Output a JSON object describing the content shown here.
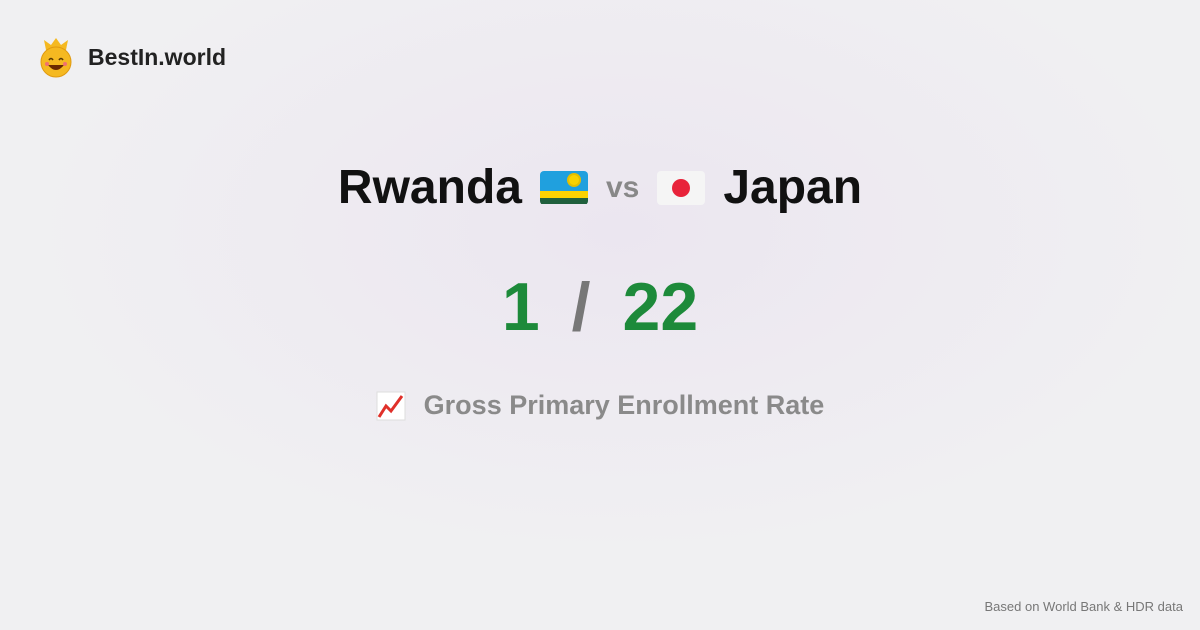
{
  "brand": {
    "name": "BestIn.world"
  },
  "comparison": {
    "left": "Rwanda",
    "vs": "vs",
    "right": "Japan",
    "left_rank": "1",
    "separator": "/",
    "right_rank": "22"
  },
  "metric": {
    "label": "Gross Primary Enrollment Rate",
    "icon": "chart-increasing-icon"
  },
  "footer": {
    "source": "Based on World Bank & HDR data"
  },
  "colors": {
    "rank": "#1d8a3a"
  }
}
